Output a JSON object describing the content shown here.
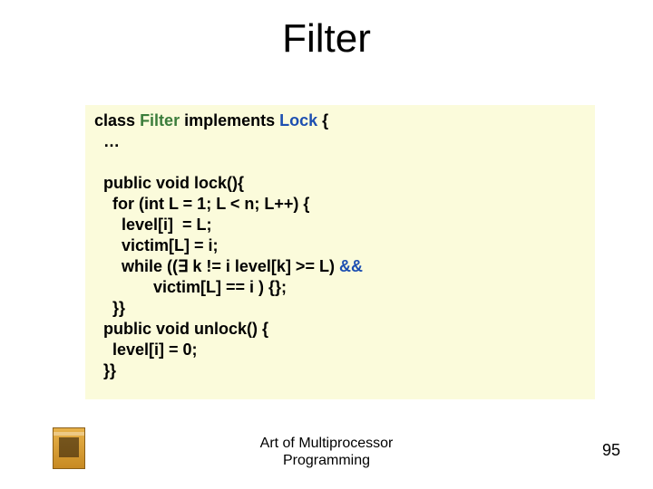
{
  "slide": {
    "title": "Filter",
    "footer_line1": "Art of Multiprocessor",
    "footer_line2": "Programming",
    "page_number": "95"
  },
  "code": {
    "l1_class": "class",
    "l1_name": "Filter",
    "l1_impl": "implements",
    "l1_lock": "Lock",
    "l1_brace": " {",
    "l2_dots": "  …",
    "blank": "",
    "l3_pub": "  public void",
    "l3_rest": " lock(){",
    "l4_for": "    for",
    "l4_int": "int",
    "l4_rest_a": " (",
    "l4_rest_b": " L = 1; L < n; L++) {",
    "l5": "      level[i]  = L;",
    "l6": "      victim[L] = i;",
    "l7_while": "      while",
    "l7_mid": " ((∃ k != i level[k] >= L) ",
    "l7_and": "&&",
    "l8": "             victim[L] == i ) {};",
    "l9": "    }}",
    "l10_pub": "  public void",
    "l10_rest": " unlock() {",
    "l11": "    level[i] = 0;",
    "l12": "  }}"
  }
}
